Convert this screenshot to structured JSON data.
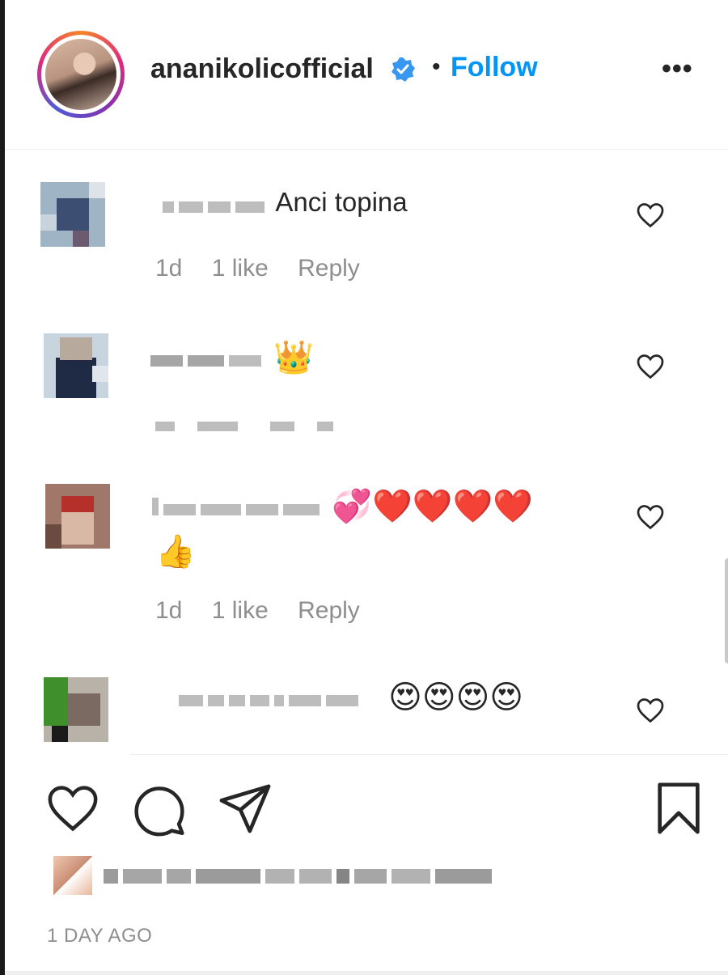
{
  "header": {
    "username": "ananikolicofficial",
    "separator": "•",
    "follow_label": "Follow",
    "more_label": "•••",
    "verified_icon": "verified-badge-icon"
  },
  "comments": [
    {
      "text": "Anci topina",
      "emoji": "",
      "meta": {
        "age": "1d",
        "likes": "1 like",
        "reply": "Reply"
      }
    },
    {
      "text": "",
      "emoji": "👑",
      "meta": {
        "age": "",
        "likes": "",
        "reply": ""
      }
    },
    {
      "text": "",
      "emoji": "💞❤️❤️❤️❤️",
      "emoji2": "👍",
      "meta": {
        "age": "1d",
        "likes": "1 like",
        "reply": "Reply"
      }
    },
    {
      "text": "",
      "emoji": "😍😍😍😍",
      "meta": {
        "age": "",
        "likes": "",
        "reply": ""
      }
    }
  ],
  "actions": {
    "like_icon": "heart-icon",
    "comment_icon": "comment-bubble-icon",
    "share_icon": "paper-plane-icon",
    "save_icon": "bookmark-icon"
  },
  "post_time": "1 DAY AGO",
  "colors": {
    "accent": "#0095f6",
    "text": "#262626",
    "secondary": "#8e8e8e"
  }
}
